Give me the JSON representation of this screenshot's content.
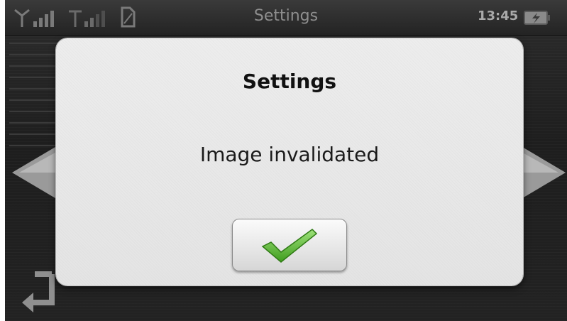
{
  "status_bar": {
    "title": "Settings",
    "clock": "13:45",
    "icons": [
      "signal-icon",
      "signal-icon",
      "sim-icon",
      "battery-icon"
    ]
  },
  "dialog": {
    "title": "Settings",
    "message": "Image invalidated",
    "confirm_icon": "checkmark-icon"
  },
  "navigation": {
    "icons": [
      "left-arrow-icon",
      "right-arrow-icon",
      "back-icon"
    ]
  },
  "colors": {
    "checkmark": "#4fb52a",
    "dialog_bg": "#e8e8e8",
    "screen_bg": "#222222"
  }
}
